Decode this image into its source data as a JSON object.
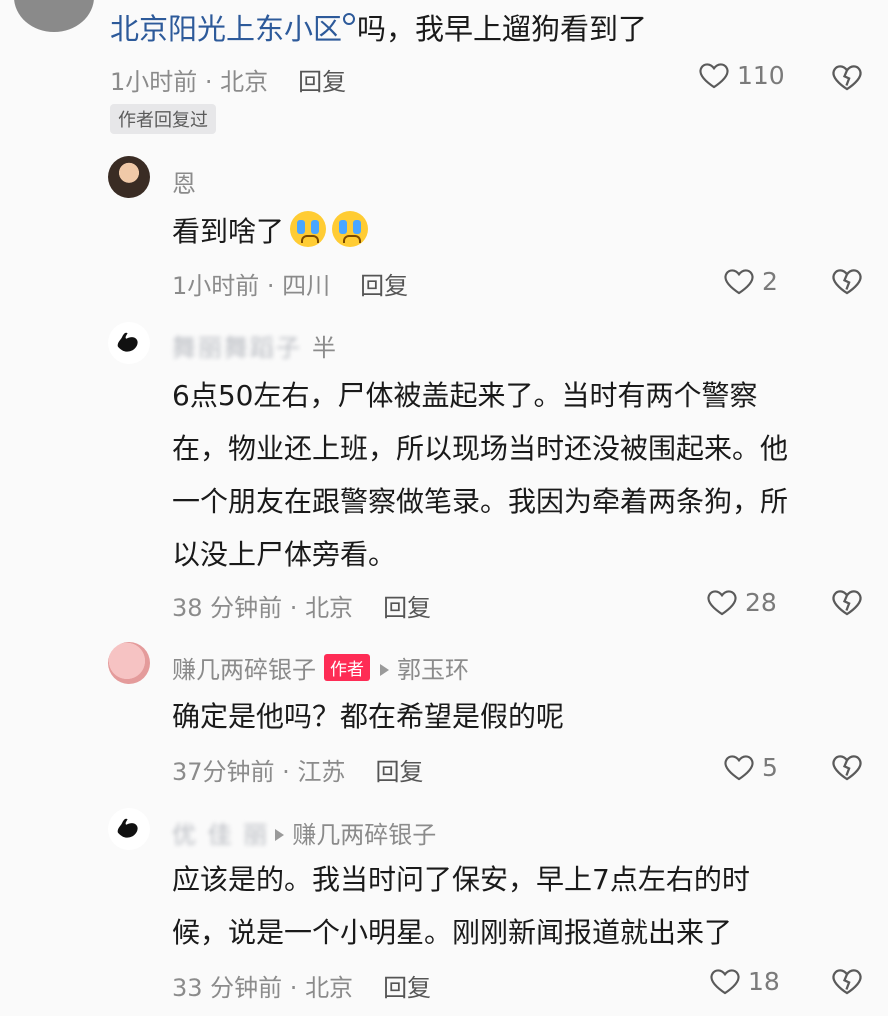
{
  "top_comment": {
    "link_text": "北京阳光上东小区",
    "text": "吗，我早上遛狗看到了",
    "time": "1小时前",
    "location": "北京",
    "reply_label": "回复",
    "likes": "110",
    "author_replied_badge": "作者回复过"
  },
  "replies": [
    {
      "username": "恩",
      "text": "看到啥了",
      "emojis": [
        "crying-emoji",
        "crying-emoji"
      ],
      "time": "1小时前",
      "location": "四川",
      "reply_label": "回复",
      "likes": "2"
    },
    {
      "username_blurred": "舞丽舞蹈子",
      "username_suffix": "半",
      "text_lines": [
        "6点50左右，尸体被盖起来了。当时有两个警察",
        "在，物业还上班，所以现场当时还没被围起来。他",
        "一个朋友在跟警察做笔录。我因为牵着两条狗，所",
        "以没上尸体旁看。"
      ],
      "time": "38 分钟前",
      "location": "北京",
      "reply_label": "回复",
      "likes": "28"
    },
    {
      "username": "赚几两碎银子",
      "author_badge": "作者",
      "reply_to": "郭玉环",
      "text": "确定是他吗？都在希望是假的呢",
      "time": "37分钟前",
      "location": "江苏",
      "reply_label": "回复",
      "likes": "5"
    },
    {
      "username_blurred": "优 佳 丽",
      "reply_to": "赚几两碎银子",
      "text_lines": [
        "应该是的。我当时问了保安，早上7点左右的时",
        "候，说是一个小明星。刚刚新闻报道就出来了"
      ],
      "time": "33 分钟前",
      "location": "北京",
      "reply_label": "回复",
      "likes": "18"
    }
  ],
  "colors": {
    "link": "#2d5a9a",
    "author_badge": "#fe2c55",
    "meta": "#8b8b8b"
  }
}
